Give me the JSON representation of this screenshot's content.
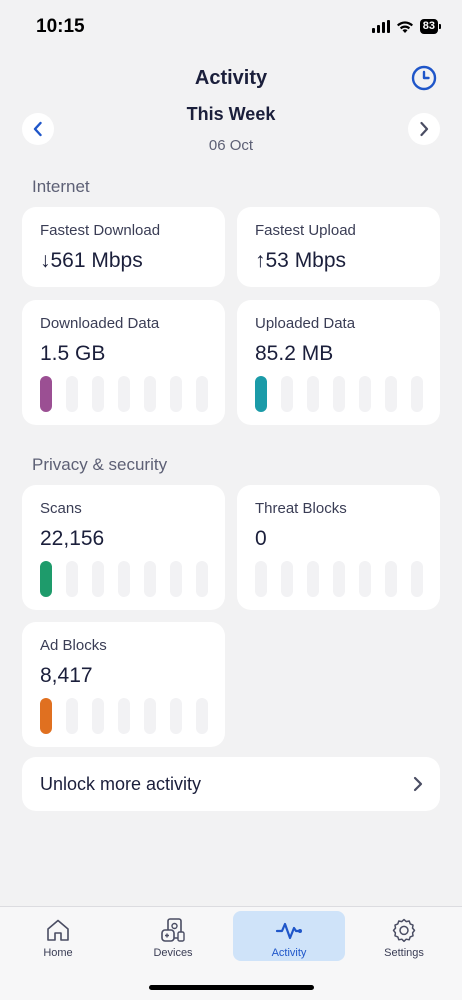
{
  "status_bar": {
    "time": "10:15",
    "battery": "83"
  },
  "header": {
    "title": "Activity",
    "period": "This Week",
    "date": "06 Oct"
  },
  "internet": {
    "label": "Internet",
    "fastest_download": {
      "label": "Fastest Download",
      "value": "↓561 Mbps"
    },
    "fastest_upload": {
      "label": "Fastest Upload",
      "value": "↑53 Mbps"
    },
    "downloaded_data": {
      "label": "Downloaded Data",
      "value": "1.5 GB",
      "bar_color": "#9b4f93"
    },
    "uploaded_data": {
      "label": "Uploaded Data",
      "value": "85.2 MB",
      "bar_color": "#1b9ba8"
    }
  },
  "privacy": {
    "label": "Privacy & security",
    "scans": {
      "label": "Scans",
      "value": "22,156",
      "bar_color": "#1e9b6b"
    },
    "threat_blocks": {
      "label": "Threat Blocks",
      "value": "0"
    },
    "ad_blocks": {
      "label": "Ad Blocks",
      "value": "8,417",
      "bar_color": "#e07020"
    }
  },
  "unlock": {
    "label": "Unlock more activity"
  },
  "tabs": [
    {
      "label": "Home",
      "icon": "home-icon",
      "active": false
    },
    {
      "label": "Devices",
      "icon": "devices-icon",
      "active": false
    },
    {
      "label": "Activity",
      "icon": "activity-icon",
      "active": true
    },
    {
      "label": "Settings",
      "icon": "gear-icon",
      "active": false
    }
  ],
  "colors": {
    "accent": "#1f56c9",
    "background": "#f2f2f3",
    "active_tab_bg": "#cfe3f9"
  }
}
